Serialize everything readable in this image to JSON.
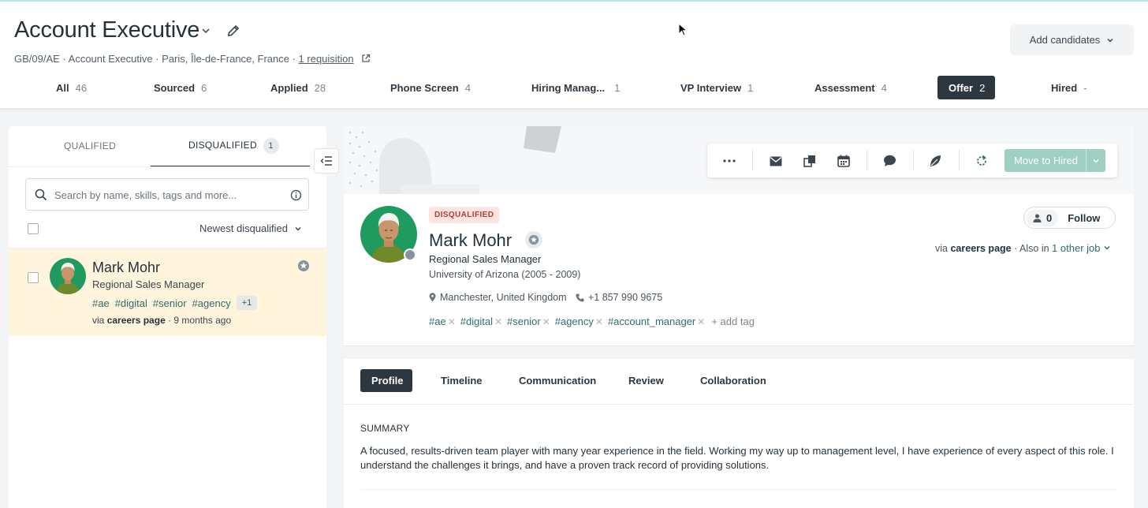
{
  "header": {
    "title": "Account Executive",
    "meta": "GB/09/AE · Account Executive · Paris, Île-de-France, France ·",
    "requisition": "1 requisition",
    "add_candidates": "Add candidates",
    "stages": [
      {
        "label": "All",
        "count": "46"
      },
      {
        "label": "Sourced",
        "count": "6"
      },
      {
        "label": "Applied",
        "count": "28"
      },
      {
        "label": "Phone Screen",
        "count": "4"
      },
      {
        "label": "Hiring Manag...",
        "count": "1"
      },
      {
        "label": "VP Interview",
        "count": "1"
      },
      {
        "label": "Assessment",
        "count": "4"
      },
      {
        "label": "Offer",
        "count": "2"
      },
      {
        "label": "Hired",
        "count": "-"
      }
    ]
  },
  "left": {
    "tab_qualified": "QUALIFIED",
    "tab_disqualified": "DISQUALIFIED",
    "disqualified_count": "1",
    "search_placeholder": "Search by name, skills, tags and more...",
    "sort_label": "Newest disqualified",
    "candidate": {
      "name": "Mark Mohr",
      "title": "Regional Sales Manager",
      "tags": [
        "#ae",
        "#digital",
        "#senior",
        "#agency"
      ],
      "more_tags": "+1",
      "via_prefix": "via",
      "via_source": "careers page",
      "via_time": "· 9 months ago"
    }
  },
  "toolbar": {
    "move_label": "Move to Hired",
    "icons": [
      "more-icon",
      "email-icon",
      "copy-icon",
      "calendar-icon",
      "comment-icon",
      "evaluate-icon",
      "refresh-icon"
    ]
  },
  "profile": {
    "status": "DISQUALIFIED",
    "name": "Mark Mohr",
    "title": "Regional Sales Manager",
    "education": "University of Arizona (2005 - 2009)",
    "location": "Manchester, United Kingdom",
    "phone": "+1 857 990 9675",
    "tags": [
      "#ae",
      "#digital",
      "#senior",
      "#agency",
      "#account_manager"
    ],
    "add_tag": "add tag",
    "followers": "0",
    "follow_label": "Follow",
    "via_prefix": "via",
    "via_source": "careers page",
    "also_in": "· Also in",
    "other_job": "1 other job"
  },
  "detail": {
    "tabs": [
      "Profile",
      "Timeline",
      "Communication",
      "Review",
      "Collaboration"
    ],
    "summary_heading": "SUMMARY",
    "summary_text": "A focused, results-driven team player with many year experience in the field. Working my way up to management level, I have experience of every aspect of this role. I understand the challenges it brings, and have a proven track record of providing solutions."
  },
  "colors": {
    "accent_teal": "#2f6d6c",
    "dark": "#2d3740",
    "move_button": "#9fcfc3",
    "disqualified_bg": "#fde6e2",
    "highlight_row": "#fff4dc"
  }
}
